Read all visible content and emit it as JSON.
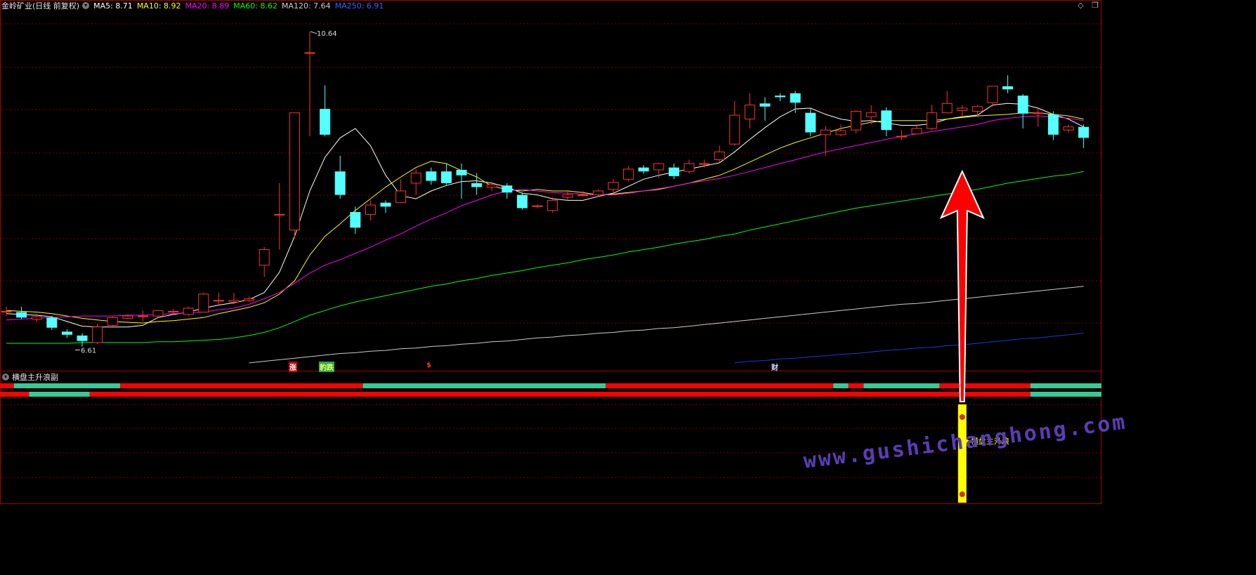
{
  "header": {
    "title": "金岭矿业(日线 前复权)",
    "ma": [
      {
        "label": "MA5: 8.71",
        "color": "#ffffff"
      },
      {
        "label": "MA10: 8.92",
        "color": "#ffff00"
      },
      {
        "label": "MA20: 8.89",
        "color": "#ff00ff"
      },
      {
        "label": "MA60: 8.62",
        "color": "#00ff00"
      },
      {
        "label": "MA120: 7.64",
        "color": "#cccccc"
      },
      {
        "label": "MA250: 6.91",
        "color": "#3366ff"
      }
    ]
  },
  "sub_panel": {
    "title": "横盘主升浪副",
    "signal_label": "横盘主升浪"
  },
  "markers": {
    "zhang": "涨",
    "baodie": "豹跌",
    "s": "$",
    "cai": "财"
  },
  "watermark": "www.gushichanghong.com",
  "colors": {
    "up": "#ff3030",
    "down": "#54ffff",
    "bar_red": "#ff0000",
    "bar_green": "#33cc99",
    "signal": "#ffff00",
    "arrow": "#ff0000"
  },
  "chart_data": {
    "type": "candlestick",
    "price_range": [
      6.3,
      10.9
    ],
    "high_label": "10.64",
    "low_label": "6.61",
    "high": 10.64,
    "low": 6.61,
    "candles": [
      [
        7.05,
        7.06,
        7.12,
        7.0
      ],
      [
        7.05,
        6.98,
        7.12,
        6.96
      ],
      [
        6.96,
        6.99,
        7.03,
        6.92
      ],
      [
        6.98,
        6.85,
        7.0,
        6.82
      ],
      [
        6.8,
        6.76,
        6.83,
        6.72
      ],
      [
        6.75,
        6.68,
        6.78,
        6.61
      ],
      [
        6.66,
        6.86,
        6.9,
        6.64
      ],
      [
        6.88,
        6.98,
        7.0,
        6.86
      ],
      [
        6.97,
        7.0,
        7.02,
        6.96
      ],
      [
        6.99,
        7.0,
        7.07,
        6.93
      ],
      [
        7.0,
        7.07,
        7.08,
        6.98
      ],
      [
        7.05,
        7.06,
        7.09,
        7.02
      ],
      [
        7.02,
        7.1,
        7.12,
        7.0
      ],
      [
        7.05,
        7.28,
        7.3,
        7.05
      ],
      [
        7.2,
        7.2,
        7.3,
        7.13
      ],
      [
        7.18,
        7.2,
        7.3,
        7.15
      ],
      [
        7.2,
        7.22,
        7.25,
        7.18
      ],
      [
        7.65,
        7.85,
        7.88,
        7.5
      ],
      [
        8.3,
        8.3,
        8.7,
        7.85
      ],
      [
        8.1,
        9.6,
        9.6,
        8.0
      ],
      [
        10.37,
        10.37,
        10.64,
        9.3
      ],
      [
        9.65,
        9.32,
        9.95,
        9.3
      ],
      [
        8.85,
        8.55,
        9.05,
        8.5
      ],
      [
        8.33,
        8.13,
        8.4,
        8.05
      ],
      [
        8.3,
        8.42,
        8.48,
        8.22
      ],
      [
        8.45,
        8.4,
        8.48,
        8.32
      ],
      [
        8.45,
        8.6,
        8.75,
        8.45
      ],
      [
        8.7,
        8.83,
        8.88,
        8.55
      ],
      [
        8.85,
        8.73,
        8.9,
        8.68
      ],
      [
        8.85,
        8.7,
        8.95,
        8.68
      ],
      [
        8.87,
        8.8,
        8.95,
        8.5
      ],
      [
        8.7,
        8.65,
        8.83,
        8.55
      ],
      [
        8.65,
        8.68,
        8.72,
        8.6
      ],
      [
        8.67,
        8.58,
        8.7,
        8.5
      ],
      [
        8.55,
        8.38,
        8.58,
        8.36
      ],
      [
        8.4,
        8.41,
        8.43,
        8.38
      ],
      [
        8.35,
        8.48,
        8.52,
        8.32
      ],
      [
        8.52,
        8.55,
        8.6,
        8.48
      ],
      [
        8.55,
        8.55,
        8.6,
        8.53
      ],
      [
        8.55,
        8.6,
        8.62,
        8.52
      ],
      [
        8.62,
        8.71,
        8.75,
        8.55
      ],
      [
        8.75,
        8.88,
        8.92,
        8.72
      ],
      [
        8.9,
        8.85,
        8.93,
        8.82
      ],
      [
        8.87,
        8.95,
        8.96,
        8.77
      ],
      [
        8.9,
        8.79,
        8.95,
        8.75
      ],
      [
        8.85,
        8.95,
        9.0,
        8.82
      ],
      [
        8.95,
        8.95,
        9.0,
        8.9
      ],
      [
        9.0,
        9.1,
        9.18,
        8.97
      ],
      [
        9.2,
        9.57,
        9.75,
        9.18
      ],
      [
        9.52,
        9.7,
        9.85,
        9.4
      ],
      [
        9.72,
        9.68,
        9.8,
        9.5
      ],
      [
        9.82,
        9.8,
        9.85,
        9.75
      ],
      [
        9.85,
        9.73,
        9.88,
        9.6
      ],
      [
        9.6,
        9.35,
        9.65,
        9.3
      ],
      [
        9.32,
        9.38,
        9.43,
        9.05
      ],
      [
        9.32,
        9.37,
        9.45,
        9.3
      ],
      [
        9.38,
        9.62,
        9.63,
        9.34
      ],
      [
        9.55,
        9.6,
        9.7,
        9.45
      ],
      [
        9.63,
        9.38,
        9.67,
        9.3
      ],
      [
        9.3,
        9.3,
        9.38,
        9.25
      ],
      [
        9.33,
        9.4,
        9.45,
        9.33
      ],
      [
        9.4,
        9.6,
        9.7,
        9.38
      ],
      [
        9.6,
        9.72,
        9.88,
        9.6
      ],
      [
        9.63,
        9.66,
        9.7,
        9.55
      ],
      [
        9.62,
        9.68,
        9.7,
        9.55
      ],
      [
        9.73,
        9.94,
        9.94,
        9.68
      ],
      [
        9.94,
        9.9,
        10.08,
        9.85
      ],
      [
        9.82,
        9.59,
        9.84,
        9.4
      ],
      [
        9.6,
        9.6,
        9.65,
        9.42
      ],
      [
        9.58,
        9.32,
        9.62,
        9.25
      ],
      [
        9.38,
        9.42,
        9.45,
        9.35
      ],
      [
        9.42,
        9.28,
        9.45,
        9.15
      ]
    ],
    "ma": [
      {
        "name": "MA5",
        "color": "#ffffff",
        "values": [
          7.03,
          7.02,
          7.01,
          6.99,
          6.93,
          6.87,
          6.86,
          6.86,
          6.86,
          6.88,
          6.98,
          7.02,
          7.05,
          7.1,
          7.14,
          7.17,
          7.21,
          7.3,
          7.56,
          8.02,
          8.6,
          9.03,
          9.28,
          9.4,
          9.18,
          8.8,
          8.54,
          8.5,
          8.6,
          8.67,
          8.72,
          8.73,
          8.7,
          8.65,
          8.57,
          8.55,
          8.5,
          8.48,
          8.48,
          8.53,
          8.57,
          8.66,
          8.75,
          8.8,
          8.84,
          8.88,
          8.92,
          8.96,
          9.1,
          9.26,
          9.41,
          9.55,
          9.65,
          9.66,
          9.58,
          9.52,
          9.49,
          9.5,
          9.47,
          9.44,
          9.44,
          9.46,
          9.52,
          9.55,
          9.57,
          9.7,
          9.72,
          9.71,
          9.66,
          9.58,
          9.52,
          9.42
        ]
      },
      {
        "name": "MA10",
        "color": "#ffff00",
        "values": [
          7.07,
          7.06,
          7.05,
          7.03,
          7.0,
          6.97,
          6.95,
          6.93,
          6.92,
          6.91,
          6.93,
          6.94,
          6.96,
          6.98,
          7.03,
          7.07,
          7.11,
          7.17,
          7.28,
          7.45,
          7.78,
          8.02,
          8.18,
          8.35,
          8.5,
          8.65,
          8.78,
          8.9,
          8.98,
          8.95,
          8.86,
          8.78,
          8.66,
          8.62,
          8.6,
          8.62,
          8.6,
          8.6,
          8.58,
          8.55,
          8.56,
          8.58,
          8.6,
          8.62,
          8.66,
          8.7,
          8.75,
          8.8,
          8.88,
          8.97,
          9.06,
          9.15,
          9.22,
          9.28,
          9.34,
          9.4,
          9.44,
          9.48,
          9.5,
          9.5,
          9.5,
          9.5,
          9.52,
          9.54,
          9.56,
          9.57,
          9.58,
          9.6,
          9.6,
          9.58,
          9.56,
          9.52
        ]
      },
      {
        "name": "MA20",
        "color": "#ff00ff",
        "values": [
          6.95,
          6.96,
          6.97,
          6.98,
          6.99,
          7.0,
          7.0,
          7.0,
          7.01,
          7.01,
          7.02,
          7.03,
          7.04,
          7.05,
          7.08,
          7.1,
          7.15,
          7.22,
          7.3,
          7.42,
          7.55,
          7.65,
          7.72,
          7.8,
          7.88,
          7.97,
          8.05,
          8.15,
          8.24,
          8.32,
          8.41,
          8.48,
          8.55,
          8.6,
          8.62,
          8.6,
          8.58,
          8.57,
          8.56,
          8.55,
          8.55,
          8.57,
          8.6,
          8.63,
          8.66,
          8.7,
          8.73,
          8.76,
          8.8,
          8.85,
          8.9,
          8.95,
          9.0,
          9.05,
          9.1,
          9.14,
          9.18,
          9.22,
          9.26,
          9.3,
          9.33,
          9.36,
          9.39,
          9.42,
          9.45,
          9.5,
          9.53,
          9.55,
          9.56,
          9.55,
          9.53,
          9.5
        ]
      },
      {
        "name": "MA60",
        "color": "#00ff00",
        "values": [
          6.65,
          6.65,
          6.65,
          6.65,
          6.65,
          6.66,
          6.66,
          6.66,
          6.66,
          6.66,
          6.67,
          6.67,
          6.68,
          6.69,
          6.7,
          6.72,
          6.75,
          6.79,
          6.85,
          6.93,
          7.01,
          7.07,
          7.13,
          7.18,
          7.22,
          7.26,
          7.3,
          7.34,
          7.38,
          7.41,
          7.45,
          7.48,
          7.52,
          7.55,
          7.58,
          7.62,
          7.65,
          7.68,
          7.72,
          7.75,
          7.78,
          7.82,
          7.85,
          7.88,
          7.92,
          7.95,
          7.98,
          8.02,
          8.05,
          8.1,
          8.14,
          8.18,
          8.22,
          8.26,
          8.3,
          8.34,
          8.38,
          8.41,
          8.44,
          8.47,
          8.5,
          8.53,
          8.56,
          8.59,
          8.62,
          8.66,
          8.7,
          8.73,
          8.76,
          8.79,
          8.81,
          8.85
        ]
      },
      {
        "name": "MA120",
        "color": "#cccccc",
        "values": [
          null,
          null,
          null,
          null,
          null,
          null,
          null,
          null,
          null,
          null,
          null,
          null,
          null,
          null,
          null,
          null,
          6.4,
          6.42,
          6.44,
          6.46,
          6.48,
          6.5,
          6.52,
          6.53,
          6.55,
          6.56,
          6.58,
          6.59,
          6.61,
          6.62,
          6.64,
          6.65,
          6.67,
          6.68,
          6.7,
          6.72,
          6.73,
          6.75,
          6.76,
          6.78,
          6.79,
          6.81,
          6.82,
          6.84,
          6.85,
          6.87,
          6.89,
          6.91,
          6.93,
          6.95,
          6.97,
          6.99,
          7.01,
          7.03,
          7.05,
          7.07,
          7.09,
          7.11,
          7.13,
          7.15,
          7.16,
          7.18,
          7.2,
          7.22,
          7.24,
          7.26,
          7.28,
          7.3,
          7.32,
          7.34,
          7.36,
          7.38
        ]
      },
      {
        "name": "MA250",
        "color": "#2233dd",
        "values": [
          null,
          null,
          null,
          null,
          null,
          null,
          null,
          null,
          null,
          null,
          null,
          null,
          null,
          null,
          null,
          null,
          null,
          null,
          null,
          null,
          null,
          null,
          null,
          null,
          null,
          null,
          null,
          null,
          null,
          null,
          null,
          null,
          null,
          null,
          null,
          null,
          null,
          null,
          null,
          null,
          null,
          null,
          null,
          null,
          null,
          null,
          null,
          null,
          6.4,
          6.42,
          6.43,
          6.45,
          6.46,
          6.48,
          6.49,
          6.51,
          6.52,
          6.54,
          6.56,
          6.57,
          6.59,
          6.6,
          6.62,
          6.63,
          6.65,
          6.67,
          6.69,
          6.71,
          6.72,
          6.74,
          6.76,
          6.78
        ]
      }
    ],
    "band1": [
      [
        "r",
        0,
        1
      ],
      [
        "g",
        1,
        8
      ],
      [
        "r",
        8,
        24
      ],
      [
        "g",
        24,
        40
      ],
      [
        "r",
        40,
        55
      ],
      [
        "g",
        55,
        56
      ],
      [
        "r",
        56,
        57
      ],
      [
        "g",
        57,
        62
      ],
      [
        "r",
        62,
        68
      ],
      [
        "g",
        68,
        73
      ]
    ],
    "band2": [
      [
        "r",
        0,
        2
      ],
      [
        "g",
        2,
        6
      ],
      [
        "r",
        6,
        68
      ],
      [
        "g",
        68,
        73
      ]
    ],
    "signal_index": 63
  }
}
